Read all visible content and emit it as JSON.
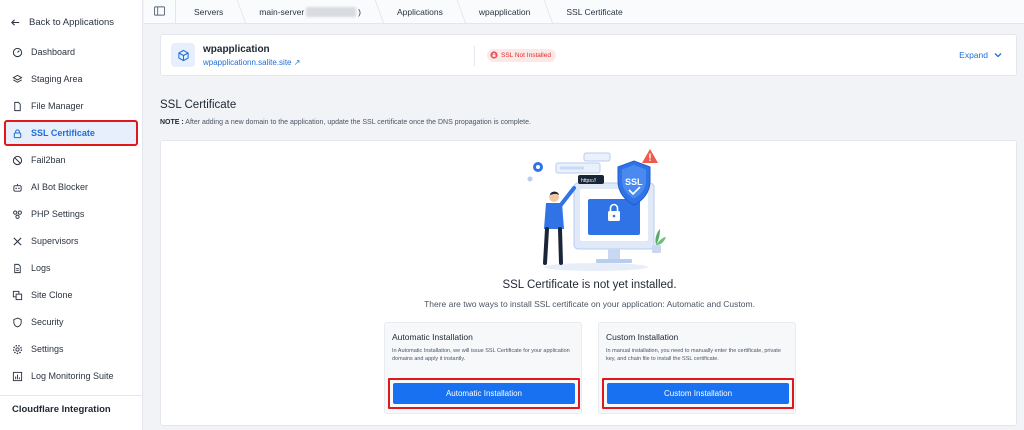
{
  "sidebar": {
    "back_label": "Back to Applications",
    "items": [
      {
        "label": "Dashboard",
        "icon": "gauge-icon"
      },
      {
        "label": "Staging Area",
        "icon": "layers-icon"
      },
      {
        "label": "File Manager",
        "icon": "file-icon"
      },
      {
        "label": "SSL Certificate",
        "icon": "lock-icon",
        "active": true
      },
      {
        "label": "Fail2ban",
        "icon": "ban-icon"
      },
      {
        "label": "AI Bot Blocker",
        "icon": "robot-icon"
      },
      {
        "label": "PHP Settings",
        "icon": "php-icon"
      },
      {
        "label": "Supervisors",
        "icon": "tools-icon"
      },
      {
        "label": "Logs",
        "icon": "logs-icon"
      },
      {
        "label": "Site Clone",
        "icon": "clone-icon"
      },
      {
        "label": "Security",
        "icon": "shield-icon"
      },
      {
        "label": "Settings",
        "icon": "gear-icon"
      },
      {
        "label": "Log Monitoring Suite",
        "icon": "chart-icon"
      }
    ],
    "cloudflare_label": "Cloudflare Integration"
  },
  "breadcrumb": {
    "servers": "Servers",
    "server_prefix": "main-server",
    "server_suffix": ")",
    "applications": "Applications",
    "app": "wpapplication",
    "current": "SSL Certificate"
  },
  "app": {
    "name": "wpapplication",
    "domain": "wpapplicationn.salite.site",
    "link_arrow": "↗",
    "status_badge": "SSL Not Installed",
    "expand_label": "Expand"
  },
  "section": {
    "title": "SSL Certificate",
    "note_label": "NOTE :",
    "note_text": " After adding a new domain to the application, update the SSL certificate once the DNS propagation is complete."
  },
  "illustration": {
    "url_text": "https://",
    "shield_text": "SSL"
  },
  "empty_state": {
    "headline": "SSL Certificate is not yet installed.",
    "subtext": "There are two ways to install SSL certificate on your application: Automatic and Custom."
  },
  "options": {
    "automatic": {
      "title": "Automatic Installation",
      "description": "In Automatic Installation, we will issue SSL Certificate for your application domains and apply it instantly.",
      "button": "Automatic Installation"
    },
    "custom": {
      "title": "Custom Installation",
      "description": "In manual installation, you need to manually enter the certificate, private key, and chain file to install the SSL certificate.",
      "button": "Custom Installation"
    }
  },
  "colors": {
    "primary": "#1771f1",
    "highlight_border": "#e0181b",
    "badge_bg": "#fde8e8",
    "badge_text": "#d93030"
  }
}
